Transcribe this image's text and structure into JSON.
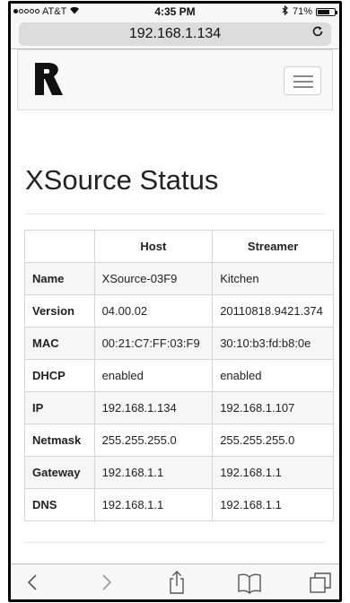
{
  "status_bar": {
    "carrier": "AT&T",
    "time": "4:35 PM",
    "battery": "71%",
    "battery_level": 0.71
  },
  "browser": {
    "url": "192.168.1.134"
  },
  "page": {
    "title": "XSource Status",
    "table": {
      "headers": [
        "",
        "Host",
        "Streamer"
      ],
      "rows": [
        [
          "Name",
          "XSource-03F9",
          "Kitchen"
        ],
        [
          "Version",
          "04.00.02",
          "20110818.9421.374"
        ],
        [
          "MAC",
          "00:21:C7:FF:03:F9",
          "30:10:b3:fd:b8:0e"
        ],
        [
          "DHCP",
          "enabled",
          "enabled"
        ],
        [
          "IP",
          "192.168.1.134",
          "192.168.1.107"
        ],
        [
          "Netmask",
          "255.255.255.0",
          "255.255.255.0"
        ],
        [
          "Gateway",
          "192.168.1.1",
          "192.168.1.1"
        ],
        [
          "DNS",
          "192.168.1.1",
          "192.168.1.1"
        ]
      ]
    }
  },
  "icons": {
    "signal": "signal-dots-icon",
    "wifi": "wifi-icon",
    "bluetooth": "bluetooth-icon",
    "battery": "battery-icon",
    "reload": "reload-icon",
    "logo": "brand-logo",
    "menu": "hamburger-menu-icon",
    "back": "back-arrow-icon",
    "forward": "forward-arrow-icon",
    "share": "share-icon",
    "bookmarks": "bookmarks-icon",
    "tabs": "tabs-icon"
  }
}
